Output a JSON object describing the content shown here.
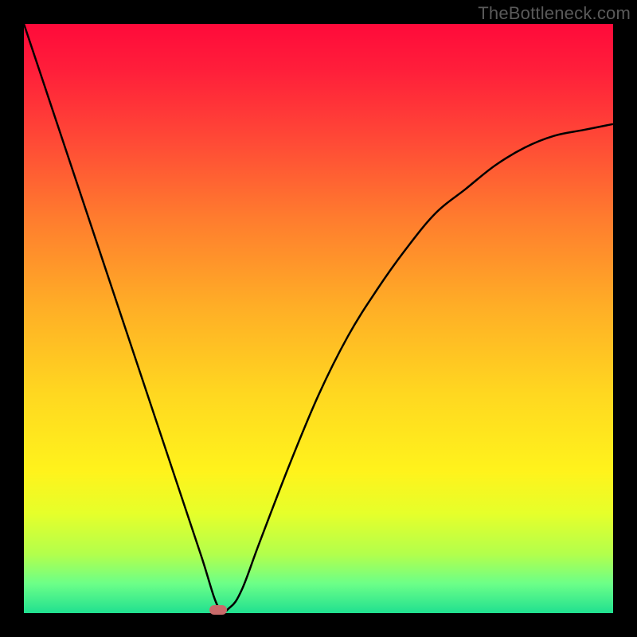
{
  "watermark": "TheBottleneck.com",
  "chart_data": {
    "type": "line",
    "title": "",
    "xlabel": "",
    "ylabel": "",
    "xlim": [
      0,
      100
    ],
    "ylim": [
      0,
      100
    ],
    "series": [
      {
        "name": "bottleneck-curve",
        "x": [
          0,
          5,
          10,
          15,
          20,
          25,
          30,
          33,
          35,
          37,
          40,
          45,
          50,
          55,
          60,
          65,
          70,
          75,
          80,
          85,
          90,
          95,
          100
        ],
        "values": [
          100,
          85,
          70,
          55,
          40,
          25,
          10,
          1,
          1,
          4,
          12,
          25,
          37,
          47,
          55,
          62,
          68,
          72,
          76,
          79,
          81,
          82,
          83
        ]
      }
    ],
    "marker": {
      "x": 33,
      "y": 0.5
    },
    "colors": {
      "curve": "#000000",
      "marker": "#c96a6a",
      "gradient_top": "#ff0a3a",
      "gradient_bottom": "#20e090"
    }
  },
  "plot_geometry": {
    "inner_left": 30,
    "inner_top": 30,
    "inner_width": 740,
    "inner_height": 740
  }
}
